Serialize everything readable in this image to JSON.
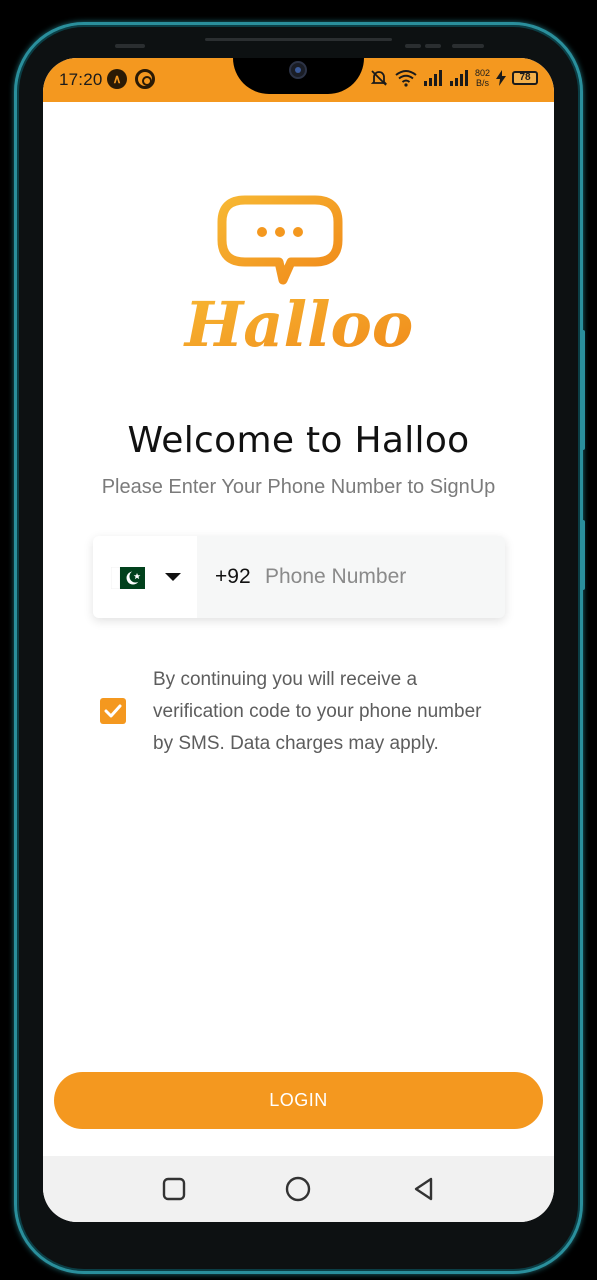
{
  "status_bar": {
    "time": "17:20",
    "net_speed_value": "802",
    "net_speed_unit": "B/s",
    "battery": "78"
  },
  "brand": {
    "logo_text": "Halloo",
    "accent_color": "#f4981f"
  },
  "welcome": {
    "title": "Welcome to Halloo",
    "subtitle": "Please Enter Your Phone Number to SignUp"
  },
  "phone_form": {
    "country_flag": "pakistan-flag",
    "dial_code": "+92",
    "phone_placeholder": "Phone Number",
    "phone_value": ""
  },
  "consent": {
    "checked": true,
    "text": "By continuing you will receive a verification code to your phone number by SMS. Data charges may apply."
  },
  "actions": {
    "login_label": "LOGIN"
  },
  "nav": {
    "recents": "square-icon",
    "home": "circle-icon",
    "back": "triangle-back-icon"
  }
}
